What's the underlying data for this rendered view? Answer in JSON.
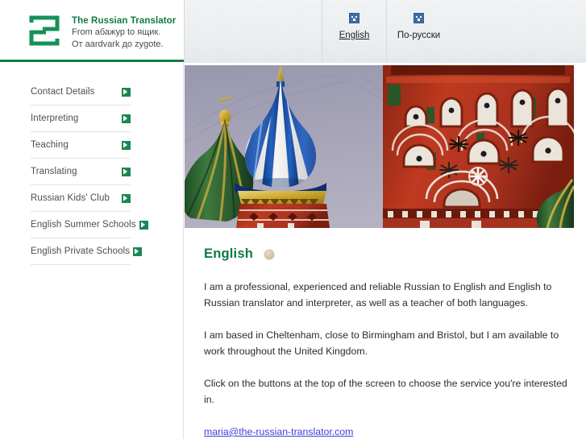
{
  "header": {
    "logo_icon": "russian-translator-logo",
    "site_title": "The Russian Translator",
    "tagline_line1": "From абажур to ящик.",
    "tagline_line2": "От aardvark до zygote.",
    "brand_color": "#0e7a46",
    "rule_color": "#19764a"
  },
  "nav": {
    "items": [
      {
        "label": "English",
        "icon": "blue-square-icon",
        "active": true
      },
      {
        "label": "По-русски",
        "icon": "blue-square-icon",
        "active": false
      }
    ]
  },
  "sidebar": {
    "items": [
      {
        "label": "Contact Details",
        "icon": "green-arrow-icon"
      },
      {
        "label": "Interpreting",
        "icon": "green-arrow-icon"
      },
      {
        "label": "Teaching",
        "icon": "green-arrow-icon"
      },
      {
        "label": "Translating",
        "icon": "green-arrow-icon"
      },
      {
        "label": "Russian Kids' Club",
        "icon": "green-arrow-icon"
      },
      {
        "label": "English Summer Schools",
        "icon": "green-arrow-icon"
      },
      {
        "label": "English Private Schools",
        "icon": "green-arrow-icon"
      }
    ],
    "arrow_color": "#1a8751"
  },
  "hero": {
    "alt": "Onion domes of Saint Basil's Cathedral, Moscow",
    "sky_color": "#a9a7bb",
    "dome_blue": "#1d52a8",
    "dome_white": "#f2f2f0",
    "dome_green": "#2f6b39",
    "brick_red": "#b9341f",
    "gold": "#d8b33c"
  },
  "main": {
    "heading": "English",
    "heading_badge_icon": "bullet-circle-icon",
    "paragraphs": [
      "I am a professional, experienced and reliable Russian to English and English to Russian translator and interpreter, as well as a teacher of both languages.",
      "I am based in Cheltenham, close to Birmingham and Bristol, but I am available to work throughout the United Kingdom.",
      "Click on the buttons at the top of the screen to choose the service you're interested in."
    ],
    "email": "maria@the-russian-translator.com",
    "link_color": "#3e3ed6"
  }
}
